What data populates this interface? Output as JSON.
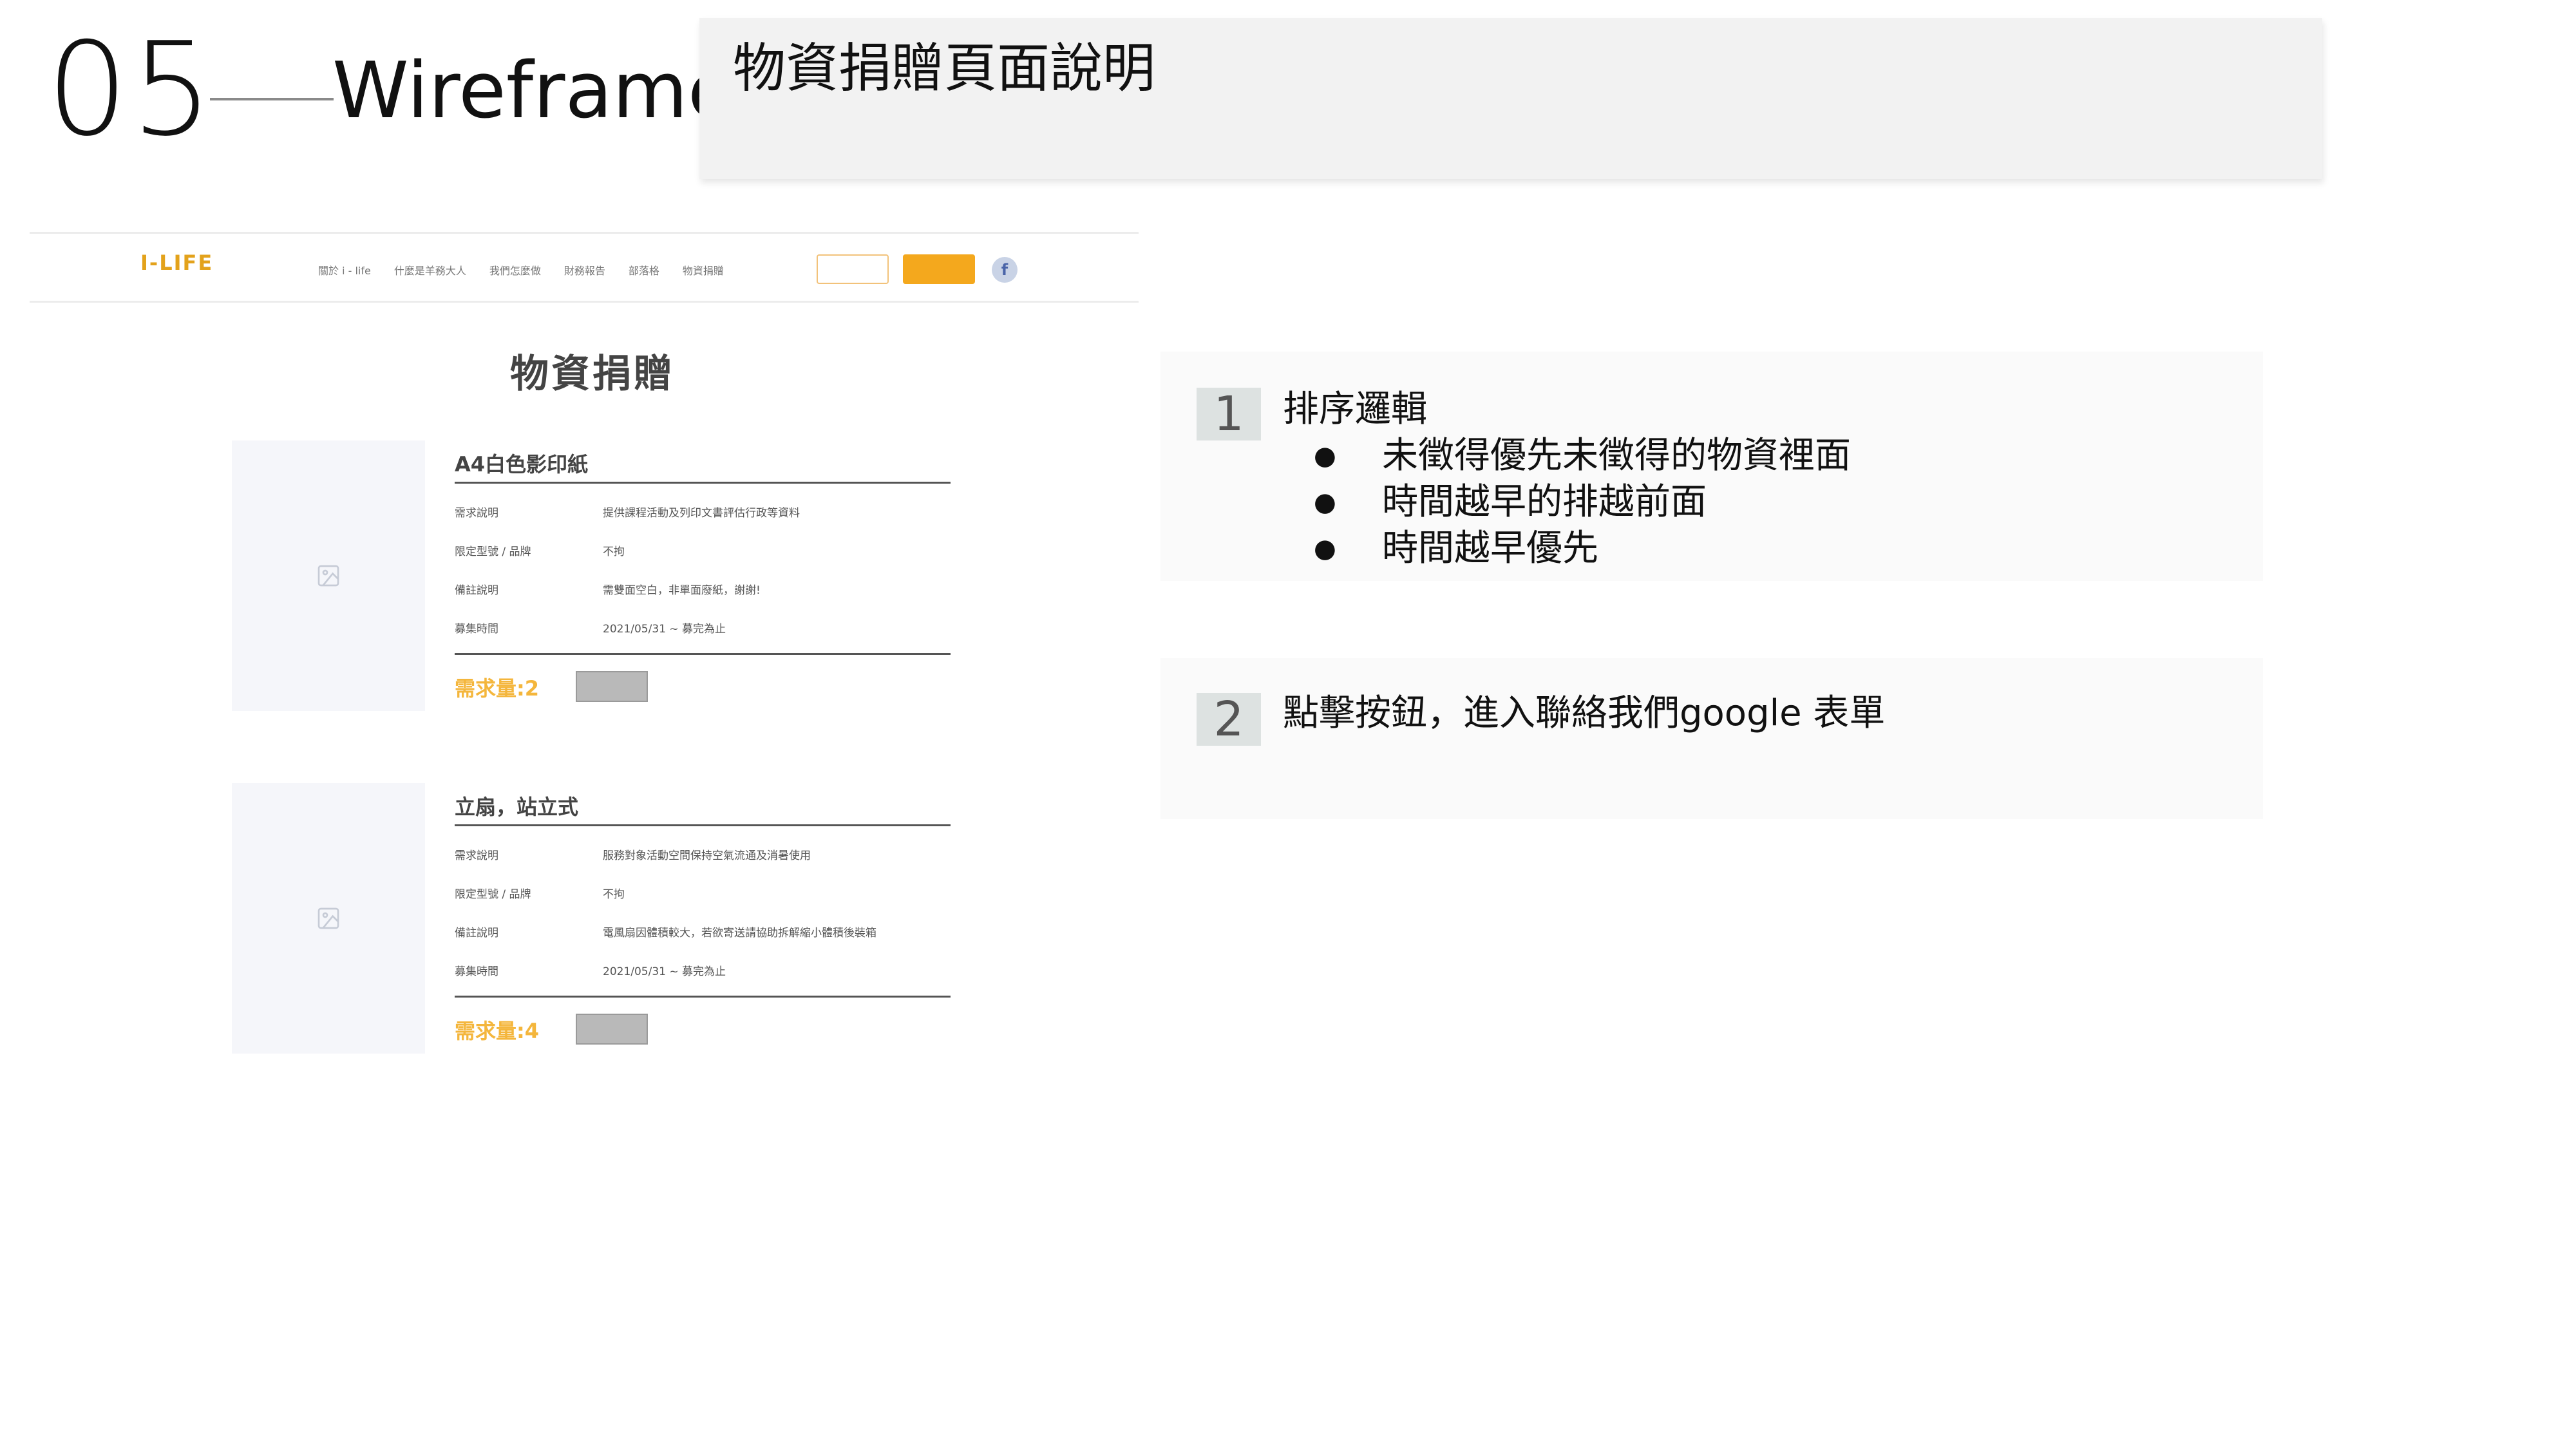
{
  "slide": {
    "number": "05",
    "title": "Wireframe",
    "card_title": "物資捐贈頁面說明"
  },
  "wireframe": {
    "logo": "I-LIFE",
    "logo_sub": "",
    "nav": [
      "關於 i - life",
      "什麼是羊務大人",
      "我們怎麼做",
      "財務報告",
      "部落格",
      "物資捐贈"
    ],
    "nav_outline_button": "",
    "nav_fill_button": "",
    "facebook_icon": "f",
    "page_heading": "物資捐贈",
    "field_labels": {
      "description": "需求說明",
      "brand": "限定型號 / 品牌",
      "remark": "備註說明",
      "period": "募集時間"
    },
    "donate_button": "",
    "items": [
      {
        "name": "A4白色影印紙",
        "description": "提供課程活動及列印文書評估行政等資料",
        "brand": "不拘",
        "remark": "需雙面空白，非單面廢紙，謝謝!",
        "period": "2021/05/31 ~ 募完為止",
        "demand": "需求量:2"
      },
      {
        "name": "立扇，站立式",
        "description": "服務對象活動空間保持空氣流通及消暑使用",
        "brand": "不拘",
        "remark": "電風扇因體積較大，若欲寄送請協助拆解縮小體積後裝箱",
        "period": "2021/05/31 ~ 募完為止",
        "demand": "需求量:4"
      }
    ]
  },
  "notes": [
    {
      "number": "1",
      "title": "排序邏輯",
      "bullets": [
        "未徵得優先未徵得的物資裡面",
        "時間越早的排越前面",
        "時間越早優先"
      ]
    },
    {
      "number": "2",
      "title": "點擊按鈕，進入聯絡我們google 表單",
      "bullets": []
    }
  ],
  "colors": {
    "accent_orange": "#f4a81d",
    "demand_yellow": "#f4b63c",
    "card_bg": "#f2f2f2",
    "number_badge_bg": "#dde2e1"
  }
}
